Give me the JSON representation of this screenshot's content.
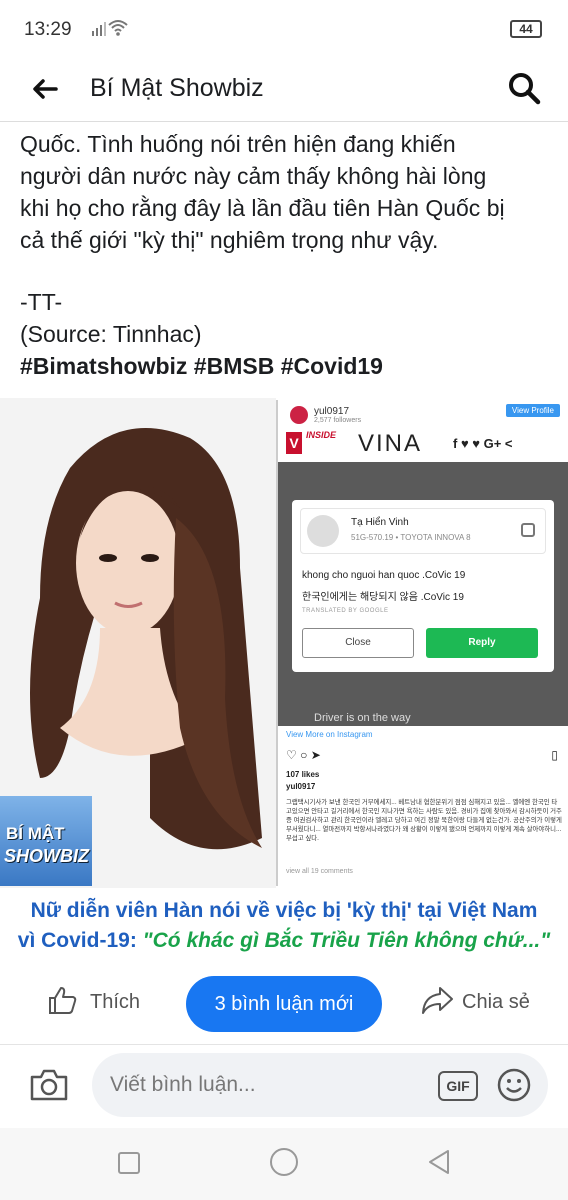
{
  "status": {
    "time": "13:29",
    "battery": "44"
  },
  "header": {
    "title": "Bí Mật Showbiz"
  },
  "post": {
    "lines": [
      "Quốc. Tình huống nói trên hiện đang khiến",
      "người dân nước này cảm thấy không hài lòng",
      "khi họ cho rằng đây là lần đầu tiên Hàn Quốc bị",
      "cả thế giới \"kỳ thị\" nghiêm trọng như vậy."
    ],
    "signature": "-TT-",
    "source": "(Source: Tinnhac)",
    "hashtags": "#Bimatshowbiz #BMSB #Covid19"
  },
  "image": {
    "logo_line1": "BÍ MẬT",
    "logo_line2": "SHOWBIZ",
    "insta": {
      "username": "yul0917",
      "followers": "2,577 followers",
      "view_profile": "View Profile",
      "banner_inside": "INSIDE",
      "banner_vina": "VINA",
      "banner_social": "f ♥ ♥ G+ <",
      "driver_name": "Tạ Hiển Vinh",
      "driver_sub": "51G-570.19 • TOYOTA INNOVA 8",
      "message1": "khong cho nguoi han quoc .CoVic 19",
      "message2": "한국인에게는 해당되지 않음 .CoVic 19",
      "translated": "TRANSLATED BY GOOGLE",
      "close": "Close",
      "reply": "Reply",
      "driver_on_way": "Driver is on the way",
      "view_more": "View More on Instagram",
      "likes": "107 likes",
      "name": "yul0917",
      "korean_text": "그랩택시기사가 보낸 한국인 거부에세지... 베트남내 협한분위기 점점 심해지고 있음... 옐에엔 한국인 타고있으면 안타고 길거리에서 한국인 지나가면 욕하는 사람도 있음. 경비가 집에 찾아와서 감시하듯이 거주증 여권검사하고 관리 한국인이라 엘레고 당하고 여긴 정말 북한이랑 다들게 없는건가. 공산주의가 이렇게 무서웠다니... 열마전까지 박항서나라였다가 왜 상황이 이렇게 됐으며 언제까지 이렇게 계속 살아야하니... 무섭고 싶다.",
      "view_all": "view all 19 comments"
    }
  },
  "caption": {
    "line1": "Nữ diễn viên Hàn nói về việc bị 'kỳ thị' tại Việt Nam",
    "line2_a": "vì Covid-19: ",
    "line2_b": "\"Có khác gì Bắc Triều Tiên không chứ...\""
  },
  "actions": {
    "like": "Thích",
    "new_comments": "3 bình luận mới",
    "share": "Chia sẻ"
  },
  "comment": {
    "placeholder": "Viết bình luận...",
    "gif": "GIF"
  }
}
